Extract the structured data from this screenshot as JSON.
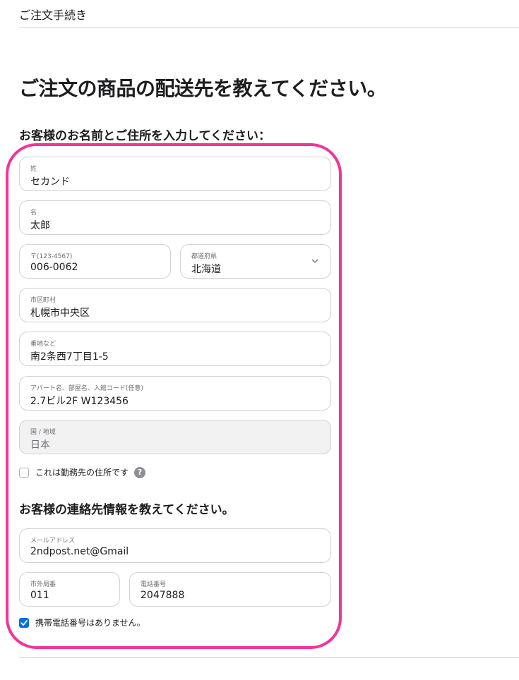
{
  "header": {
    "title": "ご注文手続き"
  },
  "page": {
    "heading": "ご注文の商品の配送先を教えてください。",
    "name_address_heading": "お客様のお名前とご住所を入力してください：",
    "contact_heading": "お客様の連絡先情報を教えてください。"
  },
  "address": {
    "last_name": {
      "label": "姓",
      "value": "セカンド"
    },
    "first_name": {
      "label": "名",
      "value": "太郎"
    },
    "postal_code": {
      "label": "〒(123-4567)",
      "value": "006-0062"
    },
    "prefecture": {
      "label": "都道府県",
      "value": "北海道"
    },
    "city": {
      "label": "市区町村",
      "value": "札幌市中央区"
    },
    "street": {
      "label": "番地など",
      "value": "南2条西7丁目1-5"
    },
    "building": {
      "label": "アパート名、部屋名、入館コード(任意)",
      "value": "2.7ビル2F W123456"
    },
    "country": {
      "label": "国 / 地域",
      "value": "日本"
    },
    "work_address": {
      "label": "これは勤務先の住所です",
      "checked": false,
      "help": "?"
    }
  },
  "contact": {
    "email": {
      "label": "メールアドレス",
      "value": "2ndpost.net@Gmail"
    },
    "area_code": {
      "label": "市外局番",
      "value": "011"
    },
    "phone": {
      "label": "電話番号",
      "value": "2047888"
    },
    "no_mobile": {
      "label": "携帯電話番号はありません。",
      "checked": true
    }
  },
  "colors": {
    "accent": "#0071e3",
    "highlight": "#f0359a",
    "border": "#d2d2d7"
  },
  "icons": {
    "select_chevron": "chevron-down-icon",
    "help": "help-icon",
    "check": "check-icon"
  }
}
